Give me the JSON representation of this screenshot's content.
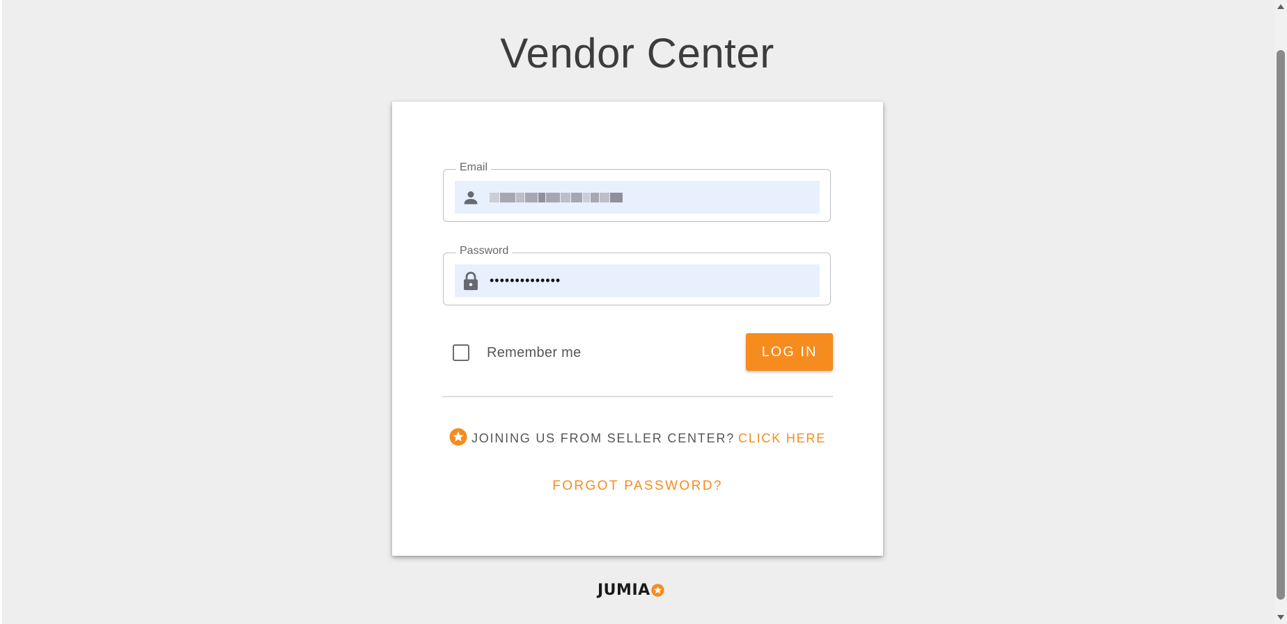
{
  "page": {
    "title": "Vendor Center"
  },
  "form": {
    "email_label": "Email",
    "email_value_note": "blurred",
    "password_label": "Password",
    "password_value": "••••••••••••••",
    "remember_label": "Remember me",
    "remember_checked": false,
    "login_label": "LOG IN"
  },
  "footer_links": {
    "seller_text": "JOINING US FROM SELLER CENTER?",
    "seller_link": "CLICK HERE",
    "forgot_password": "FORGOT PASSWORD?"
  },
  "brand": {
    "logo_text": "JUMIA",
    "accent_color": "#f68b1e"
  },
  "icons": {
    "email": "person-icon",
    "password": "lock-icon",
    "seller": "star-badge-icon",
    "logo": "star-badge-icon"
  }
}
